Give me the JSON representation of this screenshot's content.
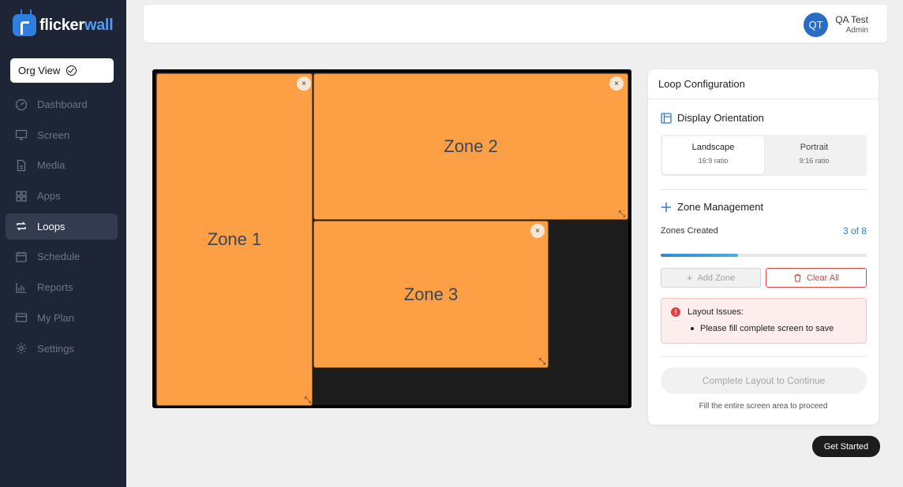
{
  "brand": {
    "name_part1": "flicker",
    "name_part2": "wall",
    "icon": "flickerwall-logo-icon"
  },
  "org_button": {
    "label": "Org View",
    "icon": "check-circle-icon"
  },
  "nav": {
    "items": [
      {
        "label": "Dashboard",
        "icon": "dashboard-icon",
        "active": false
      },
      {
        "label": "Screen",
        "icon": "monitor-icon",
        "active": false
      },
      {
        "label": "Media",
        "icon": "file-icon",
        "active": false
      },
      {
        "label": "Apps",
        "icon": "grid-icon",
        "active": false
      },
      {
        "label": "Loops",
        "icon": "loop-icon",
        "active": true
      },
      {
        "label": "Schedule",
        "icon": "calendar-icon",
        "active": false
      },
      {
        "label": "Reports",
        "icon": "bar-chart-icon",
        "active": false
      },
      {
        "label": "My Plan",
        "icon": "credit-card-icon",
        "active": false
      },
      {
        "label": "Settings",
        "icon": "gear-icon",
        "active": false
      }
    ]
  },
  "user": {
    "initials": "QT",
    "name": "QA Test",
    "role": "Admin"
  },
  "canvas": {
    "zones": [
      {
        "label": "Zone 1",
        "close": "×",
        "resize": "⤡"
      },
      {
        "label": "Zone 2",
        "close": "×",
        "resize": "⤡"
      },
      {
        "label": "Zone 3",
        "close": "×",
        "resize": "⤡"
      }
    ]
  },
  "config": {
    "title": "Loop Configuration",
    "orientation": {
      "heading": "Display Orientation",
      "options": [
        {
          "name": "Landscape",
          "ratio": "16:9 ratio",
          "selected": true
        },
        {
          "name": "Portrait",
          "ratio": "9:16 ratio",
          "selected": false
        }
      ]
    },
    "zone_management": {
      "heading": "Zone Management",
      "created_label": "Zones Created",
      "created_count": "3 of 8",
      "progress": 0.375,
      "add_label": "Add Zone",
      "clear_label": "Clear All"
    },
    "issues": {
      "heading": "Layout Issues:",
      "items": [
        "Please fill complete screen to save"
      ]
    },
    "complete_label": "Complete Layout to Continue",
    "hint": "Fill the entire screen area to proceed"
  },
  "get_started_label": "Get Started",
  "colors": {
    "zone": "#fd9f45",
    "sidebar": "#1e2536",
    "accent": "#2a7bd8",
    "danger": "#e04040"
  }
}
